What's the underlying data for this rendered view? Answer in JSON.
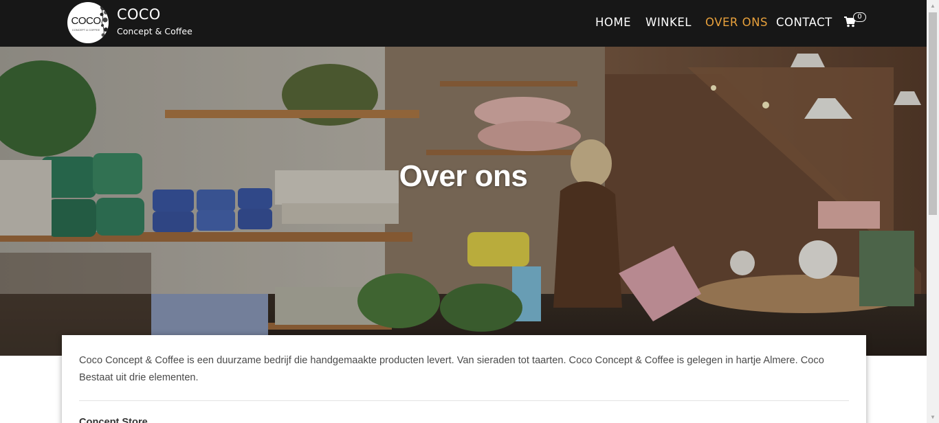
{
  "brand": {
    "logo_text": "COCO",
    "logo_subtext": "CONCEPT & COFFEE",
    "name": "COCO",
    "tagline": "Concept & Coffee"
  },
  "nav": {
    "items": [
      {
        "label": "HOME",
        "active": false
      },
      {
        "label": "WINKEL",
        "active": false
      },
      {
        "label": "OVER ONS",
        "active": true
      },
      {
        "label": "CONTACT",
        "active": false
      }
    ],
    "cart_count": "0",
    "cart_icon": "shopping-cart-icon",
    "active_color": "#e8a13c"
  },
  "hero": {
    "title": "Over ons"
  },
  "content": {
    "intro": "Coco Concept & Coffee is een duurzame bedrijf die handgemaakte producten levert. Van sieraden tot taarten. Coco Concept & Coffee is gelegen in hartje Almere. Coco Bestaat uit drie elementen.",
    "section_heading": "Concept Store"
  },
  "colors": {
    "navbar_bg": "#171717",
    "text": "#4a4a4a"
  }
}
